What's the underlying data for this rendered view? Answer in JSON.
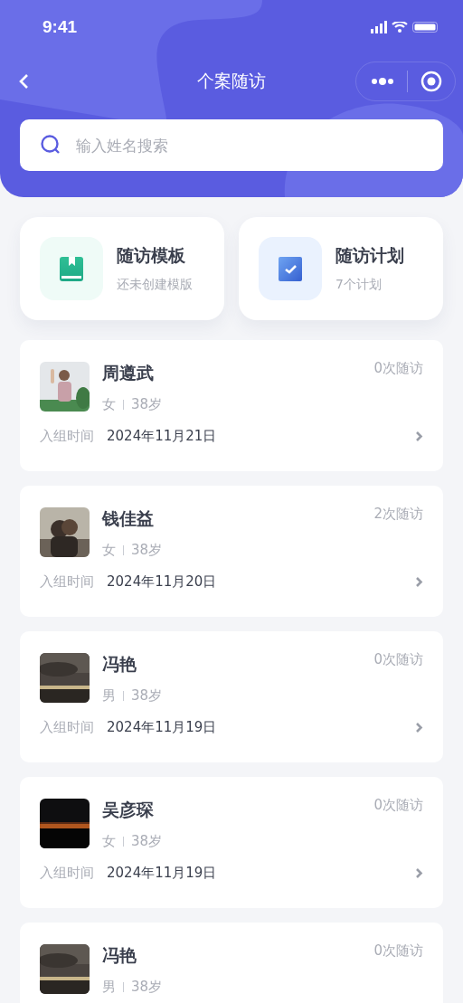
{
  "status_bar": {
    "time": "9:41"
  },
  "nav": {
    "title": "个案随访"
  },
  "search": {
    "placeholder": "输入姓名搜索"
  },
  "shortcuts": [
    {
      "kind": "template",
      "title": "随访模板",
      "subtitle": "还未创建模版"
    },
    {
      "kind": "plan",
      "title": "随访计划",
      "subtitle": "7个计划"
    }
  ],
  "cases": [
    {
      "name": "周遵武",
      "visits": "0次随访",
      "gender": "女",
      "age": "38岁",
      "joined_label": "入组时间",
      "joined": "2024年11月21日"
    },
    {
      "name": "钱佳益",
      "visits": "2次随访",
      "gender": "女",
      "age": "38岁",
      "joined_label": "入组时间",
      "joined": "2024年11月20日"
    },
    {
      "name": "冯艳",
      "visits": "0次随访",
      "gender": "男",
      "age": "38岁",
      "joined_label": "入组时间",
      "joined": "2024年11月19日"
    },
    {
      "name": "吴彦琛",
      "visits": "0次随访",
      "gender": "女",
      "age": "38岁",
      "joined_label": "入组时间",
      "joined": "2024年11月19日"
    },
    {
      "name": "冯艳",
      "visits": "0次随访",
      "gender": "男",
      "age": "38岁"
    }
  ]
}
